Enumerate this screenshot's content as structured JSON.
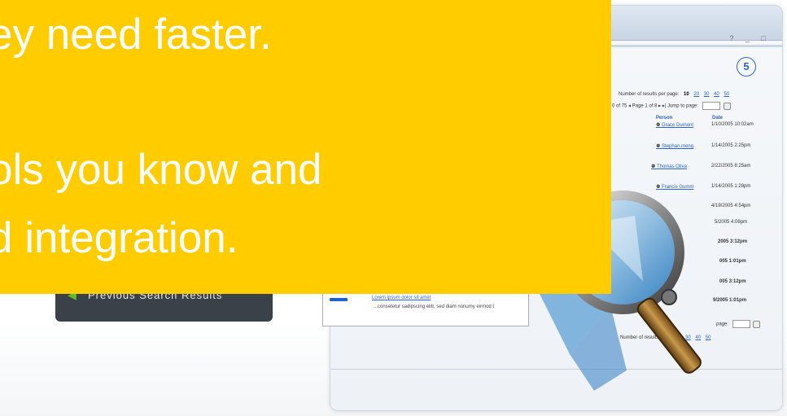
{
  "banner": {
    "line1": "ey need faster.",
    "line2": "ols you know and",
    "line3": "d integration."
  },
  "window": {
    "controls": "? _ □",
    "step_number": "5",
    "results_per_page_label": "Number of results per page:",
    "results_per_page_current": "10",
    "results_per_page_options": [
      "20",
      "30",
      "40",
      "50"
    ],
    "pager_text": "0 of 75  ◂ Page 1 of 8 ▸ ▸|  Jump to page:",
    "columns": {
      "person": "Person",
      "date": "Date"
    },
    "rows": [
      {
        "person": "Grace Dumont",
        "date": "1/10/2005 10:02am"
      },
      {
        "person": "Stephan.meng",
        "date": "1/14/2005 2:25pm"
      },
      {
        "person": "Thomas Oliva",
        "date": "2/22/2005 8:25am"
      },
      {
        "person": "Francis Gumm",
        "date": "1/14/2005 1:28pm"
      },
      {
        "person": "",
        "date": "4/19/2005 4:54pm"
      },
      {
        "person": "",
        "date": "5/2005 4:08pm"
      },
      {
        "person": "",
        "date": "2005 3:12pm"
      },
      {
        "person": "",
        "date": "005 1:01pm"
      },
      {
        "person": "",
        "date": "005 3:12pm"
      },
      {
        "person": "",
        "date": "9/2005 1:01pm"
      }
    ],
    "result_link": "Lorem ipsum dolor sit amet",
    "result_snippet": "...consetetur sadipscing elitr, sed diam nonumy eirmod t",
    "bottom_pager": "page:",
    "bottom_results_label": "Number of results per page:",
    "bottom_results_options": [
      "30",
      "40",
      "50"
    ]
  },
  "sidebar": {
    "previous_search_label": "Previous Search Results"
  },
  "colors": {
    "banner": "#ffcc00",
    "link": "#2b64c5",
    "sidebar_bg": "#3b4148",
    "arrow": "#5fbf2a"
  }
}
